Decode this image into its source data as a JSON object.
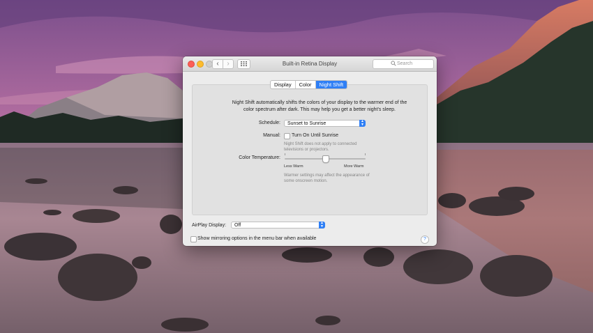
{
  "window": {
    "title": "Built-in Retina Display",
    "search_placeholder": "Search",
    "nav_back": "‹",
    "nav_forward": "›"
  },
  "tabs": [
    {
      "label": "Display",
      "active": false
    },
    {
      "label": "Color",
      "active": false
    },
    {
      "label": "Night Shift",
      "active": true
    }
  ],
  "night_shift": {
    "description": "Night Shift automatically shifts the colors of your display to the warmer end of the color spectrum after dark. This may help you get a better night's sleep.",
    "schedule_label": "Schedule:",
    "schedule_value": "Sunset to Sunrise",
    "manual_label": "Manual:",
    "manual_checkbox_label": "Turn On Until Sunrise",
    "manual_checked": false,
    "manual_note": "Night Shift does not apply to connected televisions or projectors.",
    "temperature_label": "Color Temperature:",
    "temperature_min_label": "Less Warm",
    "temperature_max_label": "More Warm",
    "temperature_value": 0.5,
    "temperature_note": "Warmer settings may affect the appearance of some onscreen motion."
  },
  "airplay": {
    "label": "AirPlay Display:",
    "value": "Off"
  },
  "mirroring": {
    "label": "Show mirroring options in the menu bar when available",
    "checked": false
  },
  "help_label": "?",
  "colors": {
    "accent": "#2f7ff5",
    "window_bg": "#ececec",
    "close": "#fc5f57",
    "minimize": "#fdbc2e",
    "zoom_inactive": "#cfcfcf"
  }
}
